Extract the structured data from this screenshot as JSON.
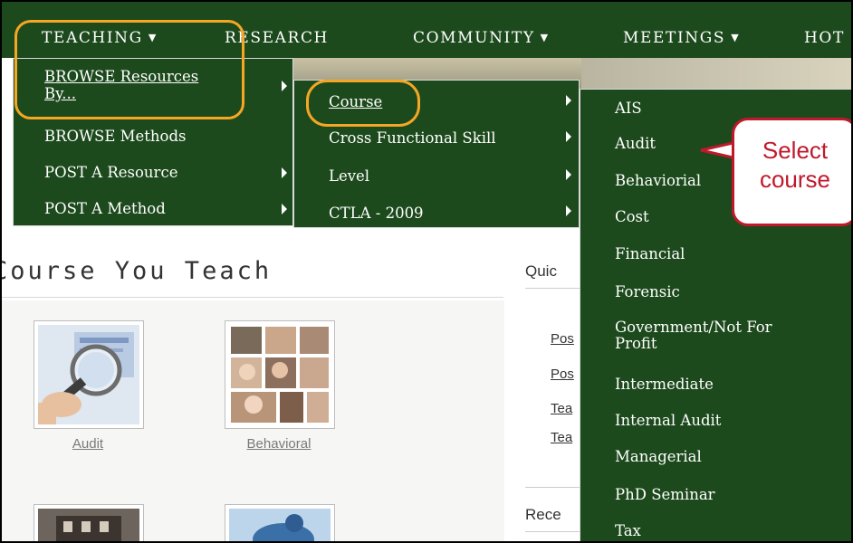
{
  "topnav": {
    "items": [
      {
        "label": "TEACHING",
        "caret": "▼"
      },
      {
        "label": "RESEARCH"
      },
      {
        "label": "COMMUNITY",
        "caret": "▼"
      },
      {
        "label": "MEETINGS",
        "caret": "▼"
      },
      {
        "label": "HOT"
      }
    ]
  },
  "teaching_menu": {
    "items": [
      {
        "label_line1": "BROWSE Resources",
        "label_line2": "By..."
      },
      {
        "label": "BROWSE Methods"
      },
      {
        "label": "POST A Resource"
      },
      {
        "label": "POST A Method"
      }
    ]
  },
  "browse_menu": {
    "items": [
      {
        "label": "Course"
      },
      {
        "label": "Cross Functional Skill"
      },
      {
        "label": "Level"
      },
      {
        "label": "CTLA - 2009"
      }
    ]
  },
  "course_menu": {
    "items": [
      {
        "label": "AIS"
      },
      {
        "label": "Audit"
      },
      {
        "label": "Behaviorial"
      },
      {
        "label": "Cost"
      },
      {
        "label": "Financial"
      },
      {
        "label": "Forensic"
      },
      {
        "label_line1": "Government/Not For",
        "label_line2": "Profit"
      },
      {
        "label": "Intermediate"
      },
      {
        "label": "Internal Audit"
      },
      {
        "label": "Managerial"
      },
      {
        "label": "PhD Seminar"
      },
      {
        "label": "Tax"
      }
    ]
  },
  "callout": {
    "line1": "Select",
    "line2": "course"
  },
  "content": {
    "heading": "Course You Teach",
    "thumbs": [
      {
        "label": "Audit"
      },
      {
        "label": "Behavioral"
      }
    ],
    "side_head_1": "Quic",
    "side_links": [
      "Pos",
      "Pos",
      "Tea",
      "Tea"
    ],
    "side_head_2": "Rece"
  },
  "colors": {
    "nav_green": "#1d4a1d",
    "annotation_orange": "#f5a623",
    "callout_red": "#c0192b"
  }
}
